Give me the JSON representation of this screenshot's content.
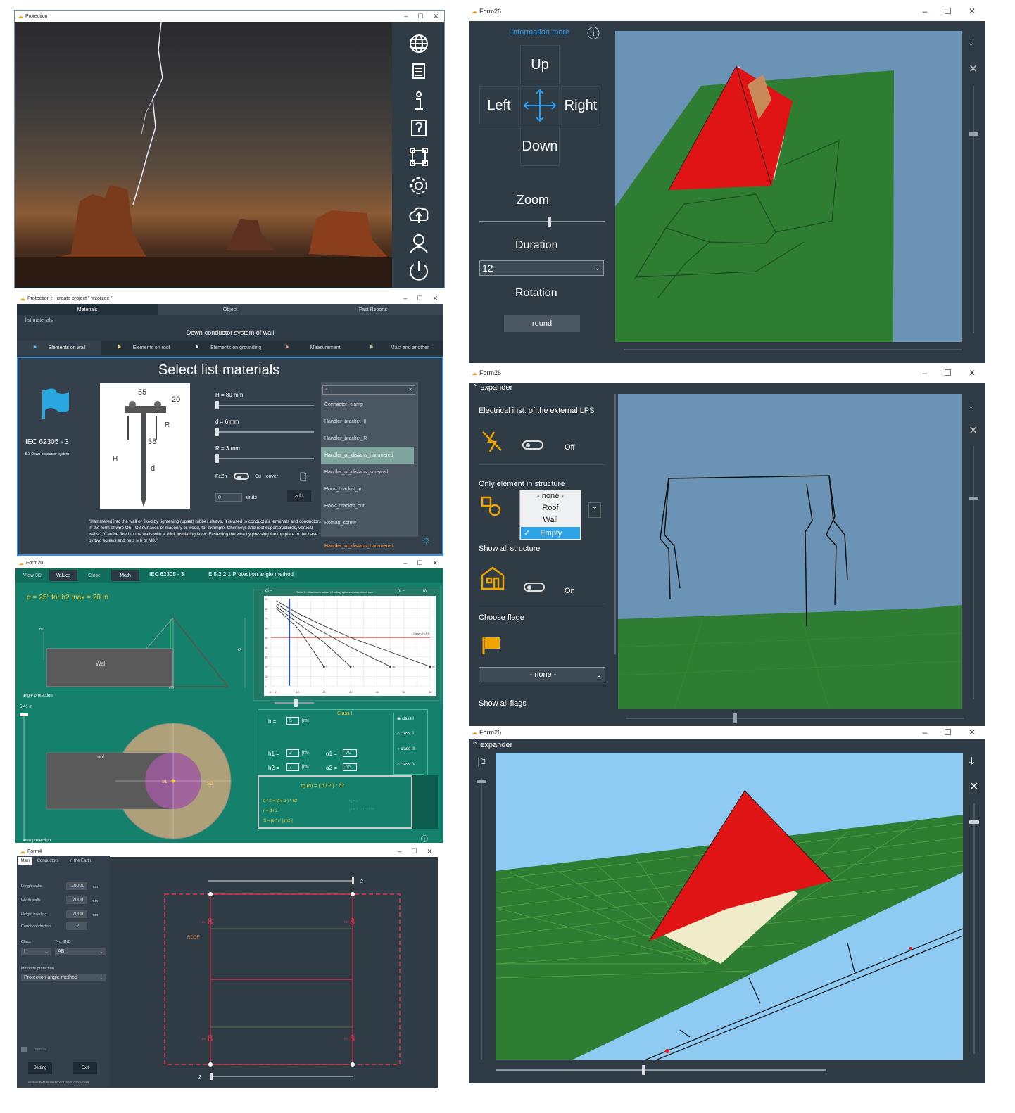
{
  "w1": {
    "title": "Protection",
    "controls": [
      "–",
      "☐",
      "✕"
    ],
    "sidebar_icons": [
      "globe-icon",
      "list-icon",
      "info-icon",
      "help-icon",
      "crop-icon",
      "gear-icon",
      "cloud-upload-icon",
      "user-icon",
      "power-icon"
    ]
  },
  "w2": {
    "title": "Protection  ::- create project \" wzorzec \"",
    "tabs": [
      "Materials",
      "Object",
      "Fast Reports"
    ],
    "breadcrumb": "list materials",
    "section_title": "Down-conductor system of wall",
    "subtabs": [
      "Elements on wall",
      "Elements on  roof",
      "Elements on grounding",
      "Measurement",
      "Mast and another"
    ],
    "heading": "Select list materials",
    "standard": "IEC 62305 - 3",
    "standard_sub": "5.3 Down-conductor system",
    "drawing": {
      "d55": "55",
      "d20": "20",
      "d38": "38",
      "R": "R",
      "H": "H",
      "d": "d"
    },
    "params": [
      "H = 80  mm",
      "d = 6  mm",
      "R = 3  mm"
    ],
    "fezn": "FeZn",
    "cu": "Cu",
    "cover": "cover",
    "units_value": "0",
    "units_label": "units",
    "add_label": "add",
    "list": [
      "Connector_clamp",
      "Handler_bracket_II",
      "Handler_bracket_R",
      "Handler_of_distans_hammered",
      "Handler_of_distans_screwed",
      "Hook_bracket_in",
      "Hook_bracket_out",
      "Roman_screw"
    ],
    "list_selected": "Handler_of_distans_hammered",
    "description": "\"Hammered into the wall or fixed by tightening (upset) rubber sleeve. It is used to conduct air terminals and conductors in the form of wire O6 - O8 surfaces of masonry or wood, for example. Chimneys and roof superstructures, vertical walls.\",\"Can be fixed to the walls with a thick insulating layer. Fastening the wire by pressing the top plate to the base by two screws and nuts M6 or M8.\""
  },
  "w3": {
    "title": "Form20",
    "tabs": [
      "View 3D",
      "Values",
      "Close",
      "Math"
    ],
    "standard": "IEC 62305 - 3",
    "method": "E.5.2.2.1 Protection angle method",
    "formula_top": "α = 25°  for   h2  max =    20 m",
    "wall": "Wall",
    "roof": "roof",
    "angle_protection": "angle protection",
    "area_protection": "area protection",
    "h1": "h1",
    "h2": "h2",
    "d2": "d2",
    "height_readout": "5.41   m",
    "s1": "S1",
    "s2": "S2",
    "chart_header": "Table 2 – Maximum values of rolling sphere radius, mesh size",
    "chart_hi": "hi =",
    "chart_m": "m",
    "chart_ai": "αi =",
    "class_label": "Class I",
    "h_value": "5",
    "h1_value": "2",
    "h2_value": "7",
    "a1_value": "70",
    "a2_value": "55",
    "m_unit": "[m]",
    "classes": [
      "class I",
      "class II",
      "class III",
      "class IV"
    ],
    "formula1": "tg (α) = ( d / 2 ) * h2",
    "formula2": "d / 2 =  tg ( α ) * h2",
    "formula3": "r = d / 2",
    "formula4": "S = pi * r²   [ m2 ]",
    "formula_side1": "tg = a *",
    "formula_side2": "pi = 3.14159265"
  },
  "chart_data": {
    "type": "line",
    "title": "",
    "x_ticks": [
      "0",
      "2",
      "10",
      "20",
      "30",
      "40",
      "50",
      "60"
    ],
    "y_ticks": [
      "90",
      "80",
      "70",
      "60",
      "50",
      "40",
      "30",
      "20",
      "10",
      "0"
    ],
    "series": [
      {
        "name": "I",
        "x": [
          2,
          10,
          20
        ],
        "y": [
          80,
          60,
          20
        ]
      },
      {
        "name": "II",
        "x": [
          2,
          10,
          20,
          30
        ],
        "y": [
          82,
          65,
          45,
          20
        ]
      },
      {
        "name": "III",
        "x": [
          2,
          10,
          20,
          30,
          45
        ],
        "y": [
          85,
          70,
          55,
          40,
          20
        ]
      },
      {
        "name": "IV",
        "x": [
          2,
          10,
          20,
          30,
          40,
          60
        ],
        "y": [
          88,
          75,
          62,
          50,
          40,
          20
        ]
      }
    ],
    "red_line_y": 50,
    "blue_line_x": 7,
    "annotation": "Class of LPS",
    "xlim": [
      0,
      60
    ],
    "ylim": [
      0,
      90
    ]
  },
  "w4": {
    "title": "Form4",
    "tabs": [
      "Main",
      "Conductors",
      "in the Earth"
    ],
    "fields": [
      {
        "label": "Longh walls",
        "value": "10000",
        "unit": "mm"
      },
      {
        "label": "Width walls",
        "value": "7000",
        "unit": "mm"
      },
      {
        "label": "Height building",
        "value": "7000",
        "unit": "mm"
      }
    ],
    "count_label": "Count conductors",
    "count_value": "2",
    "class_label": "Class",
    "typ_label": "Typ GND",
    "class_value": "I",
    "typ_value": "AB",
    "methods_label": "Methods  protection",
    "methods_value": "Protection angle method",
    "manual": "manual",
    "setting": "Setting",
    "exit": "Exit",
    "version": "version beta limited count  down conductors",
    "top_count": "2",
    "bottom_count": "2",
    "roof": "ROOF",
    "p_labels": [
      "P1",
      "P2",
      "P4",
      "P3"
    ]
  },
  "w5": {
    "title": "Form26",
    "info": "Information more",
    "up": "Up",
    "left": "Left",
    "right": "Right",
    "down": "Down",
    "zoom": "Zoom",
    "duration": "Duration",
    "duration_value": "12",
    "rotation": "Rotation",
    "round": "round"
  },
  "w6": {
    "title": "Form26",
    "expander": "expander",
    "electrical": "Electrical inst. of the external LPS",
    "off": "Off",
    "only_element": "Only element in structure",
    "options": [
      "- none -",
      "Roof",
      "Wall",
      "Empty"
    ],
    "selected": "Empty",
    "show_all_structure": "Show all structure",
    "on": "On",
    "choose_flage": "Choose flage",
    "flage_value": "- none -",
    "show_all_flags": "Show all flags"
  },
  "w7": {
    "title": "Form26",
    "expander": "expander"
  },
  "colors": {
    "dark": "#2f3b45",
    "teal": "#16806b",
    "roof_red": "#e01414",
    "grass": "#2e7d32",
    "sky": "#6b93b5",
    "sky2": "#8ecaf2",
    "accent_blue": "#1e88e5",
    "icon_orange": "#f0a500"
  }
}
